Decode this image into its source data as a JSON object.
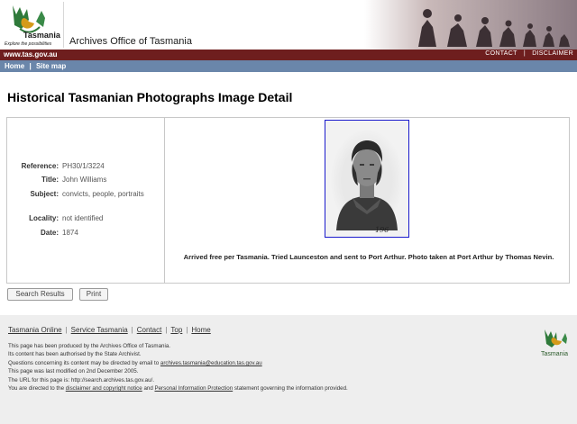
{
  "header": {
    "logo_brand": "Tasmania",
    "logo_tagline": "Explore the possibilities",
    "agency_name": "Archives Office of Tasmania"
  },
  "top_bar": {
    "site_url": "www.tas.gov.au",
    "contact_label": "CONTACT",
    "separator": "|",
    "disclaimer_label": "DISCLAIMER"
  },
  "nav": {
    "home_label": "Home",
    "separator": "|",
    "sitemap_label": "Site map"
  },
  "main": {
    "title": "Historical Tasmanian Photographs Image Detail",
    "fields": [
      {
        "label": "Reference:",
        "value": "PH30/1/3224"
      },
      {
        "label": "Title:",
        "value": "John Williams"
      },
      {
        "label": "Subject:",
        "value": "convicts, people, portraits"
      },
      {
        "label": "Locality:",
        "value": "not identified"
      },
      {
        "label": "Date:",
        "value": "1874"
      }
    ],
    "photo_number": "196",
    "caption": "Arrived free per Tasmania. Tried Launceston and sent to Port Arthur. Photo taken at Port Arthur by Thomas Nevin."
  },
  "buttons": {
    "search_results": "Search Results",
    "print": "Print"
  },
  "footer": {
    "links": [
      "Tasmania Online",
      "Service Tasmania",
      "Contact",
      "Top",
      "Home"
    ],
    "separator": "|",
    "line1": "This page has been produced by the Archives Office of Tasmania.",
    "line2": "Its content has been authorised by the State Archivist.",
    "line3_prefix": "Questions concerning its content may be directed by email to ",
    "line3_email": "archives.tasmania@education.tas.gov.au",
    "line4": "This page was last modified on 2nd December 2005.",
    "line5": "The URL for this page is: http://search.archives.tas.gov.au/.",
    "line6_prefix": "You are directed to the ",
    "line6_link1": "disclaimer and copyright notice",
    "line6_mid": " and ",
    "line6_link2": "Personal Information Protection",
    "line6_suffix": " statement governing the information provided.",
    "logo_label": "Tasmania"
  },
  "colors": {
    "top_bar": "#6e1e1e",
    "nav_bar": "#6a86aa",
    "footer_bg": "#eeeeee",
    "image_border": "#1a1acc"
  }
}
